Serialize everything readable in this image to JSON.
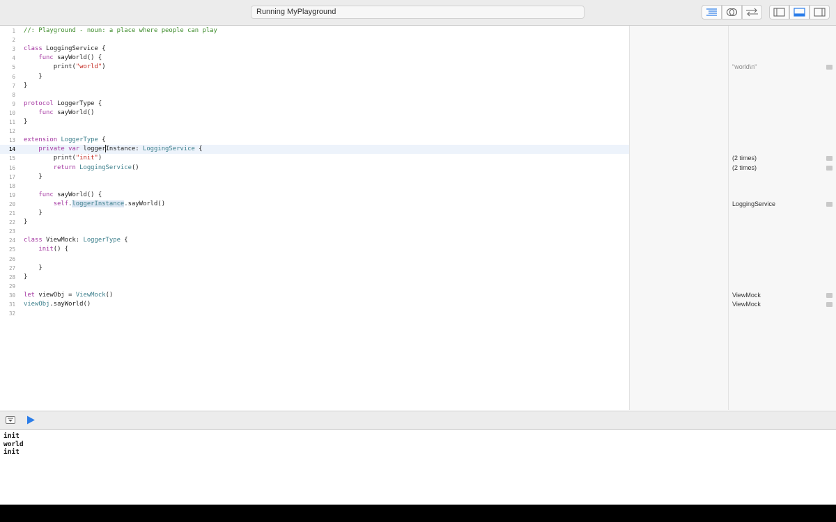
{
  "toolbar": {
    "status": "Running MyPlayground",
    "icons": [
      "editor-standard-icon",
      "editor-assistant-icon",
      "editor-version-icon",
      "navigator-toggle-icon",
      "debug-area-toggle-icon",
      "inspector-toggle-icon"
    ]
  },
  "editor": {
    "current_line": 14,
    "lines": [
      {
        "n": "1",
        "segs": [
          {
            "t": "//: Playground - noun: a place where people can play",
            "c": "cm"
          }
        ]
      },
      {
        "n": "2",
        "segs": []
      },
      {
        "n": "3",
        "segs": [
          {
            "t": "class",
            "c": "kw"
          },
          {
            "t": " LoggingService {"
          }
        ]
      },
      {
        "n": "4",
        "segs": [
          {
            "t": "    "
          },
          {
            "t": "func",
            "c": "kw"
          },
          {
            "t": " sayWorld() {"
          }
        ]
      },
      {
        "n": "5",
        "segs": [
          {
            "t": "        print("
          },
          {
            "t": "\"world\"",
            "c": "str"
          },
          {
            "t": ")"
          }
        ]
      },
      {
        "n": "6",
        "segs": [
          {
            "t": "    }"
          }
        ]
      },
      {
        "n": "7",
        "segs": [
          {
            "t": "}"
          }
        ]
      },
      {
        "n": "8",
        "segs": []
      },
      {
        "n": "9",
        "segs": [
          {
            "t": "protocol",
            "c": "kw"
          },
          {
            "t": " LoggerType {"
          }
        ]
      },
      {
        "n": "10",
        "segs": [
          {
            "t": "    "
          },
          {
            "t": "func",
            "c": "kw"
          },
          {
            "t": " sayWorld()"
          }
        ]
      },
      {
        "n": "11",
        "segs": [
          {
            "t": "}"
          }
        ]
      },
      {
        "n": "12",
        "segs": []
      },
      {
        "n": "13",
        "segs": [
          {
            "t": "extension",
            "c": "kw"
          },
          {
            "t": " "
          },
          {
            "t": "LoggerType",
            "c": "tp"
          },
          {
            "t": " {"
          }
        ]
      },
      {
        "n": "14",
        "segs": [
          {
            "t": "    "
          },
          {
            "t": "private",
            "c": "kw"
          },
          {
            "t": " "
          },
          {
            "t": "var",
            "c": "kw"
          },
          {
            "t": " logger"
          },
          {
            "cursor": true
          },
          {
            "t": "Instance: "
          },
          {
            "t": "LoggingService",
            "c": "tp"
          },
          {
            "t": " {"
          }
        ]
      },
      {
        "n": "15",
        "segs": [
          {
            "t": "        print("
          },
          {
            "t": "\"init\"",
            "c": "str"
          },
          {
            "t": ")"
          }
        ]
      },
      {
        "n": "16",
        "segs": [
          {
            "t": "        "
          },
          {
            "t": "return",
            "c": "kw"
          },
          {
            "t": " "
          },
          {
            "t": "LoggingService",
            "c": "tp"
          },
          {
            "t": "()"
          }
        ]
      },
      {
        "n": "17",
        "segs": [
          {
            "t": "    }"
          }
        ]
      },
      {
        "n": "18",
        "segs": []
      },
      {
        "n": "19",
        "segs": [
          {
            "t": "    "
          },
          {
            "t": "func",
            "c": "kw"
          },
          {
            "t": " sayWorld() {"
          }
        ]
      },
      {
        "n": "20",
        "segs": [
          {
            "t": "        "
          },
          {
            "t": "self",
            "c": "kw"
          },
          {
            "t": "."
          },
          {
            "t": "loggerInstance",
            "c": "tp sel"
          },
          {
            "t": ".sayWorld()"
          }
        ]
      },
      {
        "n": "21",
        "segs": [
          {
            "t": "    }"
          }
        ]
      },
      {
        "n": "22",
        "segs": [
          {
            "t": "}"
          }
        ]
      },
      {
        "n": "23",
        "segs": []
      },
      {
        "n": "24",
        "segs": [
          {
            "t": "class",
            "c": "kw"
          },
          {
            "t": " ViewMock: "
          },
          {
            "t": "LoggerType",
            "c": "tp"
          },
          {
            "t": " {"
          }
        ]
      },
      {
        "n": "25",
        "segs": [
          {
            "t": "    "
          },
          {
            "t": "init",
            "c": "kw"
          },
          {
            "t": "() {"
          }
        ]
      },
      {
        "n": "26",
        "segs": []
      },
      {
        "n": "27",
        "segs": [
          {
            "t": "    }"
          }
        ]
      },
      {
        "n": "28",
        "segs": [
          {
            "t": "}"
          }
        ]
      },
      {
        "n": "29",
        "segs": []
      },
      {
        "n": "30",
        "segs": [
          {
            "t": "let",
            "c": "kw"
          },
          {
            "t": " viewObj = "
          },
          {
            "t": "ViewMock",
            "c": "tp"
          },
          {
            "t": "()"
          }
        ]
      },
      {
        "n": "31",
        "segs": [
          {
            "t": "viewObj",
            "c": "tp"
          },
          {
            "t": ".sayWorld()"
          }
        ]
      },
      {
        "n": "32",
        "segs": []
      }
    ]
  },
  "results": [
    {
      "line": 5,
      "text": "\"world\\n\"",
      "kind": "str"
    },
    {
      "line": 15,
      "text": "(2 times)"
    },
    {
      "line": 16,
      "text": "(2 times)"
    },
    {
      "line": 20,
      "text": "LoggingService"
    },
    {
      "line": 30,
      "text": "ViewMock"
    },
    {
      "line": 31,
      "text": "ViewMock"
    }
  ],
  "console": {
    "lines": [
      "init",
      "world",
      "init"
    ]
  },
  "colors": {
    "keyword": "#a335a0",
    "type": "#3c7f8c",
    "string": "#c3271f",
    "comment": "#3b8a28",
    "accent": "#2b7de9"
  }
}
